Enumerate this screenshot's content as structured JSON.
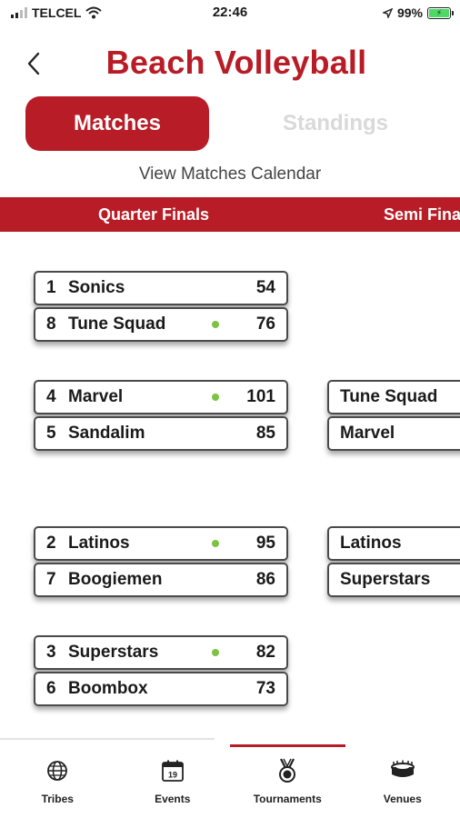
{
  "status_bar": {
    "carrier": "TELCEL",
    "time": "22:46",
    "battery": "99%"
  },
  "header": {
    "title": "Beach Volleyball"
  },
  "tabs": {
    "matches": "Matches",
    "standings": "Standings",
    "active": "matches"
  },
  "calendar_link": "View Matches Calendar",
  "rounds": [
    "Quarter Finals",
    "Semi Finals"
  ],
  "quarter_finals": [
    {
      "teams": [
        {
          "seed": "1",
          "name": "Sonics",
          "score": "54",
          "winner": false
        },
        {
          "seed": "8",
          "name": "Tune Squad",
          "score": "76",
          "winner": true
        }
      ]
    },
    {
      "teams": [
        {
          "seed": "4",
          "name": "Marvel",
          "score": "101",
          "winner": true
        },
        {
          "seed": "5",
          "name": "Sandalim",
          "score": "85",
          "winner": false
        }
      ]
    },
    {
      "teams": [
        {
          "seed": "2",
          "name": "Latinos",
          "score": "95",
          "winner": true
        },
        {
          "seed": "7",
          "name": "Boogiemen",
          "score": "86",
          "winner": false
        }
      ]
    },
    {
      "teams": [
        {
          "seed": "3",
          "name": "Superstars",
          "score": "82",
          "winner": true
        },
        {
          "seed": "6",
          "name": "Boombox",
          "score": "73",
          "winner": false
        }
      ]
    }
  ],
  "semi_finals": [
    {
      "teams": [
        {
          "name": "Tune Squad"
        },
        {
          "name": "Marvel"
        }
      ]
    },
    {
      "teams": [
        {
          "name": "Latinos"
        },
        {
          "name": "Superstars"
        }
      ]
    }
  ],
  "bottom_nav": [
    {
      "label": "Tribes",
      "icon": "globe-icon",
      "active": false
    },
    {
      "label": "Events",
      "icon": "calendar-icon",
      "icon_text": "19",
      "active": false
    },
    {
      "label": "Tournaments",
      "icon": "medal-icon",
      "active": true
    },
    {
      "label": "Venues",
      "icon": "stadium-icon",
      "active": false
    }
  ],
  "colors": {
    "brand_red": "#b81c26",
    "winner_dot": "#7dc242",
    "inactive_tab": "#d9d9d9"
  }
}
